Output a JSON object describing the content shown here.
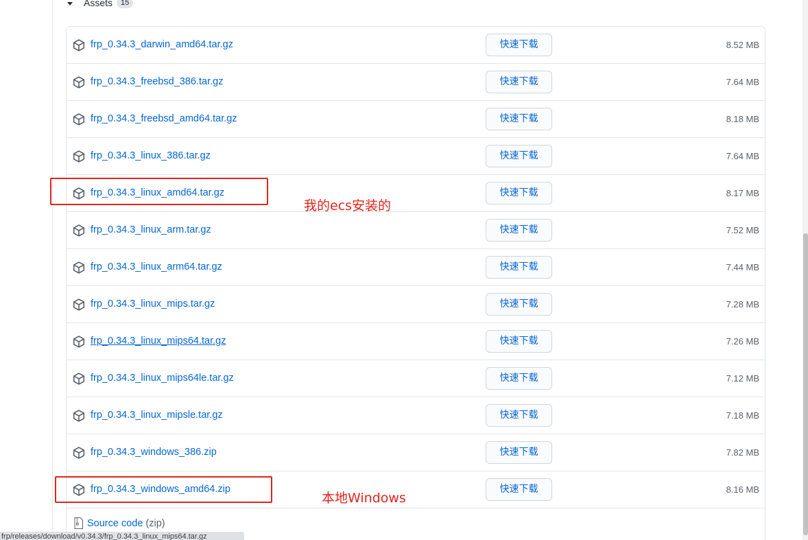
{
  "assets": {
    "label": "Assets",
    "count": "15",
    "download_button_label": "快速下载",
    "rows": [
      {
        "name": "frp_0.34.3_darwin_amd64.tar.gz",
        "size": "8.52 MB"
      },
      {
        "name": "frp_0.34.3_freebsd_386.tar.gz",
        "size": "7.64 MB"
      },
      {
        "name": "frp_0.34.3_freebsd_amd64.tar.gz",
        "size": "8.18 MB"
      },
      {
        "name": "frp_0.34.3_linux_386.tar.gz",
        "size": "7.64 MB"
      },
      {
        "name": "frp_0.34.3_linux_amd64.tar.gz",
        "size": "8.17 MB"
      },
      {
        "name": "frp_0.34.3_linux_arm.tar.gz",
        "size": "7.52 MB"
      },
      {
        "name": "frp_0.34.3_linux_arm64.tar.gz",
        "size": "7.44 MB"
      },
      {
        "name": "frp_0.34.3_linux_mips.tar.gz",
        "size": "7.28 MB"
      },
      {
        "name": "frp_0.34.3_linux_mips64.tar.gz",
        "size": "7.26 MB"
      },
      {
        "name": "frp_0.34.3_linux_mips64le.tar.gz",
        "size": "7.12 MB"
      },
      {
        "name": "frp_0.34.3_linux_mipsle.tar.gz",
        "size": "7.18 MB"
      },
      {
        "name": "frp_0.34.3_windows_386.zip",
        "size": "7.82 MB"
      },
      {
        "name": "frp_0.34.3_windows_amd64.zip",
        "size": "8.16 MB"
      }
    ],
    "source_code": {
      "label": "Source code",
      "type": "(zip)"
    }
  },
  "annotations": {
    "linux_note": "我的ecs安装的",
    "windows_note": "本地Windows"
  },
  "status_bar": {
    "url": "frp/releases/download/v0.34.3/frp_0.34.3_linux_mips64.tar.gz"
  },
  "colors": {
    "link": "#0366d6",
    "annotation": "#e0241c",
    "border": "#e1e4e8"
  }
}
